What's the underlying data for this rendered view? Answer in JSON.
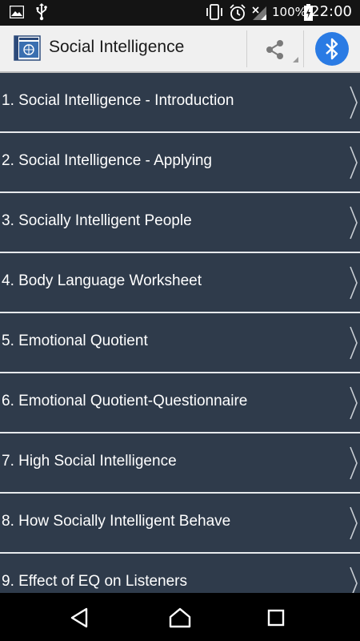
{
  "status_bar": {
    "battery_percent": "100%",
    "time": "22:00",
    "icons": [
      "image-icon",
      "usb-icon",
      "vibrate-icon",
      "alarm-icon",
      "signal-icon",
      "battery-charging-icon"
    ]
  },
  "app_bar": {
    "title": "Social Intelligence",
    "icons": [
      "app-logo",
      "share-icon",
      "bluetooth-icon"
    ],
    "bluetooth_color": "#2a7be4"
  },
  "list": {
    "items": [
      {
        "label": "1. Social Intelligence - Introduction"
      },
      {
        "label": "2. Social Intelligence - Applying"
      },
      {
        "label": "3. Socially Intelligent People"
      },
      {
        "label": "4. Body Language Worksheet"
      },
      {
        "label": "5. Emotional Quotient"
      },
      {
        "label": "6. Emotional Quotient-Questionnaire"
      },
      {
        "label": "7. High Social Intelligence"
      },
      {
        "label": "8. How Socially Intelligent Behave"
      },
      {
        "label": "9. Effect of EQ on Listeners"
      }
    ],
    "background_color": "#2f3b4b",
    "divider_color": "#e6e9ec"
  },
  "nav_bar": {
    "icons": [
      "back-icon",
      "home-icon",
      "recents-icon"
    ]
  }
}
